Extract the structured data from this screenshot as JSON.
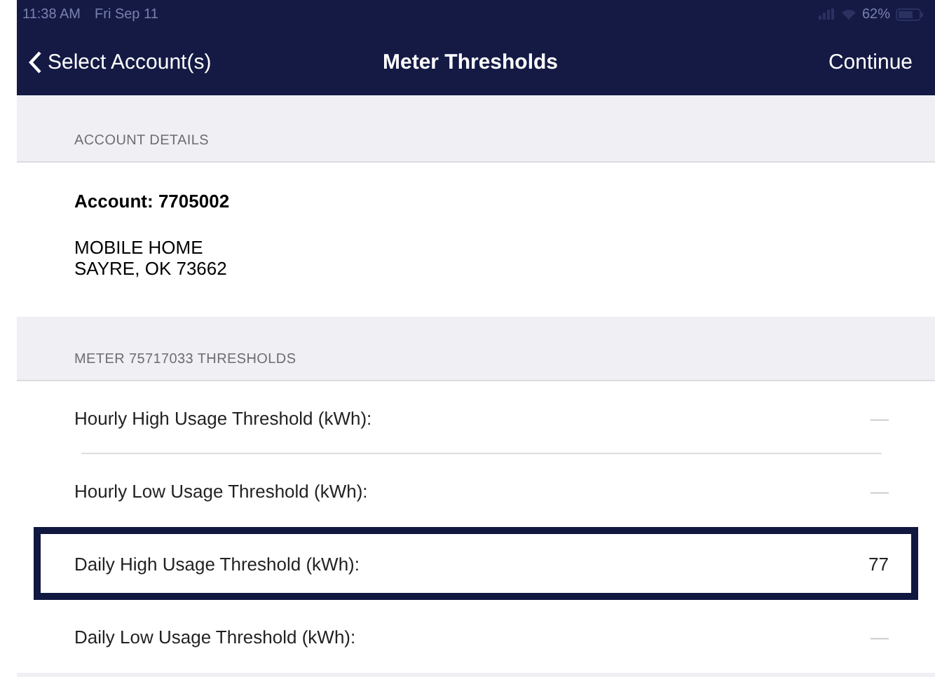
{
  "status_bar": {
    "time": "11:38 AM",
    "date": "Fri Sep 11",
    "battery": "62%"
  },
  "nav": {
    "back": "Select Account(s)",
    "title": "Meter Thresholds",
    "action": "Continue"
  },
  "account_section": {
    "header": "ACCOUNT DETAILS",
    "account": "Account: 7705002",
    "address_lines": [
      "MOBILE HOME",
      "SAYRE, OK 73662"
    ]
  },
  "thresholds_section": {
    "header": "METER 75717033 THRESHOLDS",
    "rows": [
      {
        "label": "Hourly High Usage Threshold (kWh):",
        "placeholder": "—",
        "value": "",
        "focused": false
      },
      {
        "label": "Hourly Low Usage Threshold (kWh):",
        "placeholder": "—",
        "value": "",
        "focused": false
      },
      {
        "label": "Daily High Usage Threshold (kWh):",
        "value": "77",
        "focused": true
      },
      {
        "label": "Daily Low Usage Threshold (kWh):",
        "placeholder": "—",
        "value": "",
        "focused": false
      }
    ]
  }
}
